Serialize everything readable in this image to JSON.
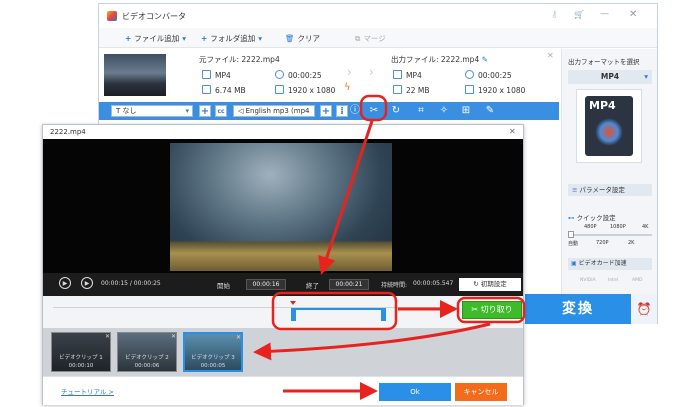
{
  "app": {
    "title": "ビデオコンバータ"
  },
  "toolbar": {
    "add_file": "ファイル追加",
    "add_folder": "フォルダ追加",
    "clear": "クリア",
    "merge": "マージ"
  },
  "source": {
    "label": "元ファイル: 2222.mp4",
    "format": "MP4",
    "duration": "00:00:25",
    "size": "6.74 MB",
    "resolution": "1920 x 1080"
  },
  "output": {
    "label": "出力ファイル: 2222.mp4",
    "format": "MP4",
    "duration": "00:00:25",
    "size": "22 MB",
    "resolution": "1920 x 1080"
  },
  "editbar": {
    "subtitle": "なし",
    "audio": "English mp3 (mp4"
  },
  "right_panel": {
    "format_label": "出力フォーマットを選択",
    "format": "MP4",
    "format_badge": "MP4",
    "param_button": "パラメータ設定",
    "quick_label": "クイック設定",
    "quality_top": [
      "480P",
      "1080P",
      "4K"
    ],
    "quality_bottom": [
      "自動",
      "720P",
      "2K"
    ],
    "gpu_label": "ビデオカード加速",
    "gpu_brands": [
      "NVIDIA",
      "Intel",
      "AMD"
    ]
  },
  "convert": {
    "label": "変換"
  },
  "dialog": {
    "title": "2222.mp4",
    "current_time": "00:00:15 / 00:00:25",
    "start_label": "開始",
    "start_value": "00:00:16",
    "end_label": "終了",
    "end_value": "00:00:21",
    "duration_label": "持続時間:",
    "duration_value": "00:00:05.547",
    "reset": "初期設定",
    "cut": "切り取り",
    "tutorial": "チュートリアル >",
    "ok": "Ok",
    "cancel": "キャンセル",
    "clips": [
      {
        "name": "ビデオクリップ 1",
        "time": "00:00:10"
      },
      {
        "name": "ビデオクリップ 2",
        "time": "00:00:06"
      },
      {
        "name": "ビデオクリップ 3",
        "time": "00:00:05"
      }
    ]
  },
  "colors": {
    "accent": "#2a8fe6",
    "cut": "#3dbb2a",
    "cancel": "#f26c1b",
    "annotation": "#e8231e"
  }
}
